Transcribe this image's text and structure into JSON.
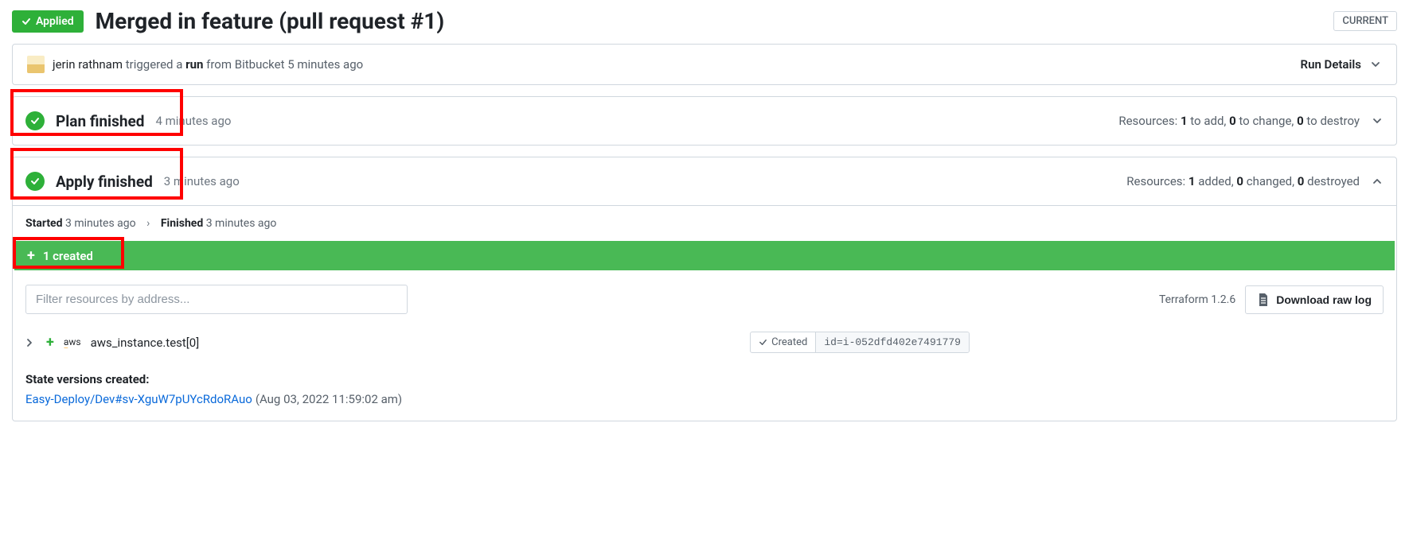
{
  "header": {
    "status_badge": "Applied",
    "title": "Merged in feature (pull request #1)",
    "current_label": "CURRENT"
  },
  "run_details": {
    "user": "jerin rathnam",
    "triggered_text": " triggered a ",
    "run_word": "run",
    "from_text": " from Bitbucket 5 minutes ago",
    "link_label": "Run Details"
  },
  "plan": {
    "title": "Plan finished",
    "time_ago": "4 minutes ago",
    "resources_prefix": "Resources: ",
    "to_add": "1",
    "to_add_text": " to add, ",
    "to_change": "0",
    "to_change_text": " to change, ",
    "to_destroy": "0",
    "to_destroy_text": " to destroy"
  },
  "apply": {
    "title": "Apply finished",
    "time_ago": "3 minutes ago",
    "resources_prefix": "Resources: ",
    "added": "1",
    "added_text": " added, ",
    "changed": "0",
    "changed_text": " changed, ",
    "destroyed": "0",
    "destroyed_text": " destroyed",
    "started_label": "Started",
    "started_time": "3 minutes ago",
    "finished_label": "Finished",
    "finished_time": "3 minutes ago",
    "created_bar": "1 created",
    "filter_placeholder": "Filter resources by address...",
    "terraform_version": "Terraform 1.2.6",
    "download_label": "Download raw log"
  },
  "resource": {
    "provider": "aws",
    "name": "aws_instance.test[0]",
    "status": "Created",
    "id": "id=i-052dfd402e7491779"
  },
  "state": {
    "heading": "State versions created:",
    "link": "Easy-Deploy/Dev#sv-XguW7pUYcRdoRAuo",
    "timestamp": "(Aug 03, 2022 11:59:02 am)"
  }
}
